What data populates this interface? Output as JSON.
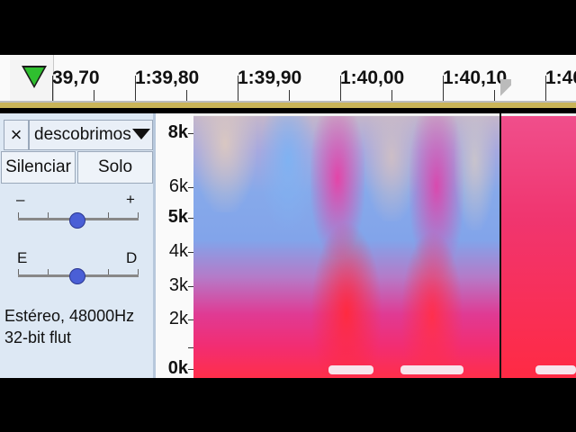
{
  "timeline": {
    "labels": [
      "39,70",
      "1:39,80",
      "1:39,90",
      "1:40,00",
      "1:40,10",
      "1:40"
    ]
  },
  "track": {
    "name": "descobrimos",
    "close_label": "×",
    "mute_label": "Silenciar",
    "solo_label": "Solo",
    "gain_minus": "–",
    "gain_plus": "+",
    "pan_left": "E",
    "pan_right": "D",
    "format_line1": "Estéreo, 48000Hz",
    "format_line2": "32-bit flut"
  },
  "freq_axis": {
    "labels": [
      "8k",
      "6k",
      "5k",
      "4k",
      "3k",
      "2k",
      "0k"
    ]
  },
  "colors": {
    "panel_bg": "#dde8f4",
    "play_green": "#2fbf2f",
    "thumb_blue": "#4a5fd6",
    "spectrogram_low": "#ff2e4a",
    "spectrogram_mid": "#86a9ea",
    "spectrogram_high": "#c6b7c9"
  },
  "icons": {
    "play": "play-triangle-icon",
    "dropdown": "chevron-down-icon",
    "close": "close-icon"
  }
}
